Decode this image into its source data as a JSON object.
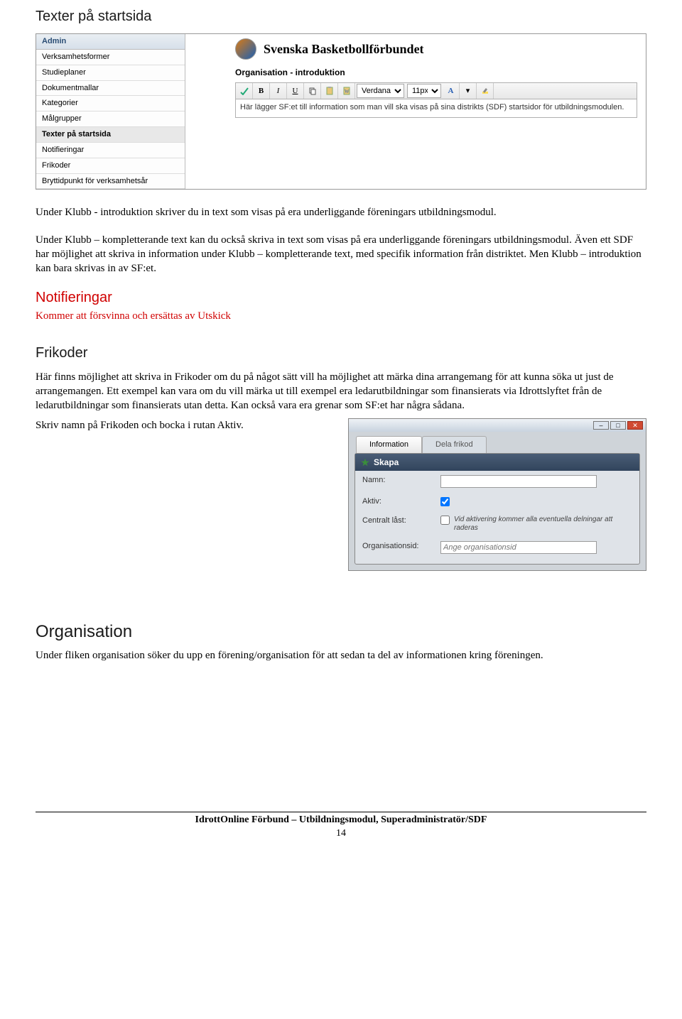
{
  "headings": {
    "texter": "Texter på startsida",
    "notifieringar": "Notifieringar",
    "frikoder": "Frikoder",
    "organisation": "Organisation"
  },
  "paragraphs": {
    "p1": "Under Klubb - introduktion skriver du in text som visas på era underliggande föreningars utbildningsmodul.",
    "p2": "Under Klubb – kompletterande text kan du också skriva in text som visas på era underliggande föreningars utbildningsmodul. Även ett SDF har möjlighet att skriva in information under Klubb – kompletterande text, med specifik information från distriktet. Men Klubb – introduktion kan bara skrivas in av SF:et.",
    "not_sub": "Kommer att försvinna och ersättas av Utskick",
    "frik_body": "Här finns möjlighet att skriva in Frikoder om du på något sätt vill ha möjlighet att märka dina arrangemang för att kunna söka ut just de arrangemangen. Ett exempel kan vara om du vill märka ut till exempel era ledarutbildningar som finansierats via Idrottslyftet från de ledarutbildningar som finansierats utan detta. Kan också vara era grenar som SF:et har några sådana.",
    "frik_action": "Skriv namn på Frikoden och bocka i rutan Aktiv.",
    "org_body": "Under fliken organisation söker du upp en förening/organisation för att sedan ta del av informationen kring föreningen."
  },
  "shot1": {
    "sidebar_header": "Admin",
    "items": [
      "Verksamhetsformer",
      "Studieplaner",
      "Dokumentmallar",
      "Kategorier",
      "Målgrupper",
      "Texter på startsida",
      "Notifieringar",
      "Frikoder",
      "Bryttidpunkt för verksamhetsår"
    ],
    "brand": "Svenska Basketbollförbundet",
    "subline": "Organisation - introduktion",
    "font_family": "Verdana",
    "font_size": "11px",
    "editor_text": "Här lägger SF:et till information som man vill ska visas på sina distrikts (SDF) startsidor för utbildningsmodulen."
  },
  "shot2": {
    "tabs": {
      "t1": "Information",
      "t2": "Dela frikod"
    },
    "panel_title": "Skapa",
    "rows": {
      "namn_label": "Namn:",
      "aktiv_label": "Aktiv:",
      "central_label": "Centralt låst:",
      "central_note": "Vid aktivering kommer alla eventuella delningar att raderas",
      "orgid_label": "Organisationsid:",
      "orgid_placeholder": "Ange organisationsid"
    },
    "winbtns": {
      "min": "–",
      "max": "□",
      "close": "✕"
    }
  },
  "footer": {
    "line": "IdrottOnline Förbund – Utbildningsmodul, Superadministratör/SDF",
    "page": "14"
  }
}
